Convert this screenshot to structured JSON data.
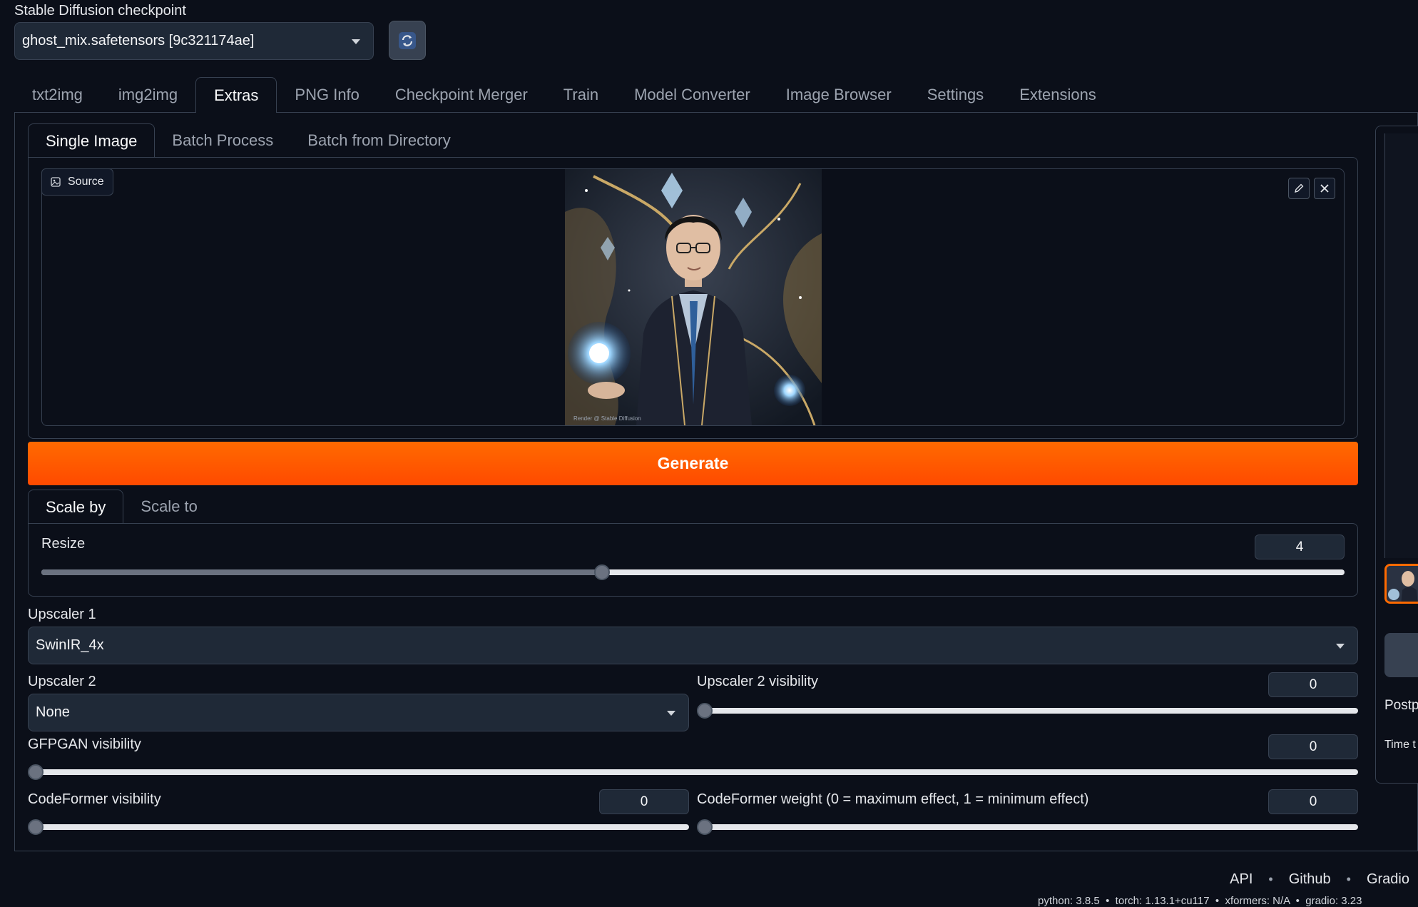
{
  "checkpoint": {
    "label": "Stable Diffusion checkpoint",
    "value": "ghost_mix.safetensors [9c321174ae]",
    "refresh_icon": "refresh-icon"
  },
  "tabs": [
    "txt2img",
    "img2img",
    "Extras",
    "PNG Info",
    "Checkpoint Merger",
    "Train",
    "Model Converter",
    "Image Browser",
    "Settings",
    "Extensions"
  ],
  "active_tab": "Extras",
  "subtabs": [
    "Single Image",
    "Batch Process",
    "Batch from Directory"
  ],
  "active_subtab": "Single Image",
  "source": {
    "label": "Source",
    "image_desc_icon": "image-icon",
    "edit_icon": "pencil-icon",
    "close_icon": "close-icon",
    "watermark": "Render @ Stable Diffusion"
  },
  "generate_label": "Generate",
  "scale_tabs": [
    "Scale by",
    "Scale to"
  ],
  "active_scale_tab": "Scale by",
  "resize": {
    "label": "Resize",
    "value": "4",
    "fraction": 0.43
  },
  "upscaler1": {
    "label": "Upscaler 1",
    "value": "SwinIR_4x"
  },
  "upscaler2": {
    "label": "Upscaler 2",
    "value": "None"
  },
  "upscaler2_visibility": {
    "label": "Upscaler 2 visibility",
    "value": "0",
    "fraction": 0
  },
  "gfpgan": {
    "label": "GFPGAN visibility",
    "value": "0",
    "fraction": 0
  },
  "codeformer_visibility": {
    "label": "CodeFormer visibility",
    "value": "0",
    "fraction": 0
  },
  "codeformer_weight": {
    "label": "CodeFormer weight (0 = maximum effect, 1 = minimum effect)",
    "value": "0",
    "fraction": 0
  },
  "right_panel": {
    "postprocess_text": "Postp",
    "time_text": "Time t"
  },
  "footer": {
    "links": [
      "API",
      "Github",
      "Gradio"
    ],
    "sep": "•",
    "versions": "python: 3.8.5  •  torch: 1.13.1+cu117  •  xformers: N/A  •  gradio: 3.23"
  },
  "colors": {
    "accent": "#ff5500",
    "background": "#0b0f19",
    "border": "#374151"
  }
}
